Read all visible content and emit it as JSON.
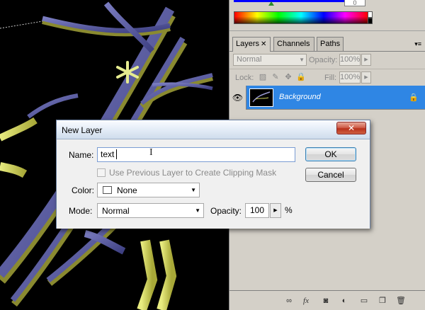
{
  "color_panel": {
    "value_box": "0"
  },
  "layers_panel": {
    "tabs": [
      {
        "label": "Layers",
        "close": "✕"
      },
      {
        "label": "Channels"
      },
      {
        "label": "Paths"
      }
    ],
    "menu_icon": "▾≡",
    "blend_mode": "Normal",
    "opacity_label": "Opacity:",
    "opacity_value": "100%",
    "lock_label": "Lock:",
    "fill_label": "Fill:",
    "fill_value": "100%",
    "layers": [
      {
        "name": "Background",
        "visible": true,
        "locked": true
      }
    ],
    "bottom_icons": [
      "link-icon",
      "fx-icon",
      "mask-icon",
      "adjustment-icon",
      "group-folder-icon",
      "new-layer-icon",
      "trash-icon"
    ],
    "fx_label": "fx"
  },
  "dialog": {
    "title": "New Layer",
    "close_glyph": "✕",
    "name_label": "Name:",
    "name_value": "text",
    "clip_label": "Use Previous Layer to Create Clipping Mask",
    "clip_checked": false,
    "color_label": "Color:",
    "color_value": "None",
    "mode_label": "Mode:",
    "mode_value": "Normal",
    "opacity_label": "Opacity:",
    "opacity_value": "100",
    "percent": "%",
    "ok_label": "OK",
    "cancel_label": "Cancel"
  },
  "colors": {
    "selection_blue": "#2f86e4",
    "dialog_close_red": "#c8402a",
    "ribbon_purple": "#55589a",
    "ribbon_yellow": "#c8c858"
  }
}
